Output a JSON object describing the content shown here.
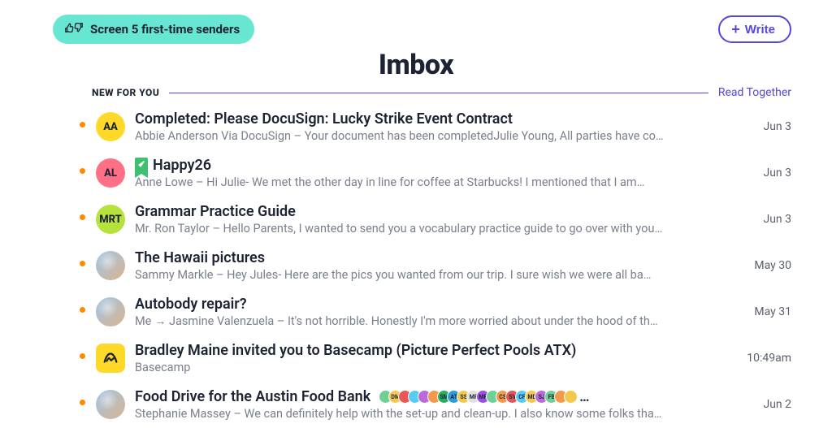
{
  "screener": {
    "label": "Screen 5 first-time senders"
  },
  "write_button": {
    "label": "Write"
  },
  "title": "Imbox",
  "section": {
    "label": "NEW FOR YOU",
    "action": "Read Together"
  },
  "avatars": {
    "aa": {
      "text": "AA",
      "bg": "#ffd92a"
    },
    "al": {
      "text": "AL",
      "bg": "#ff6f86"
    },
    "mrt": {
      "text": "MRT",
      "bg": "#b6e23c"
    },
    "bc_bg": "#ffd92a"
  },
  "mini_colors": [
    "#6fcf97",
    "#f2c94c",
    "#eb5757",
    "#56ccf2",
    "#bb6bd9",
    "#f2994a",
    "#27ae60",
    "#2d9cdb",
    "#f2c94c",
    "#e0e0e0",
    "#9b51e0",
    "#6fcf97",
    "#f2994a",
    "#e05757",
    "#56ccf2",
    "#f2c94c",
    "#bb6bd9",
    "#6fcf97",
    "#f2994a",
    "#f2c94c"
  ],
  "mini_labels": [
    "",
    "DM",
    "",
    "",
    "",
    "",
    "SM",
    "AT",
    "SS",
    "MF",
    "MR",
    "",
    "CS",
    "SV",
    "CP",
    "MD",
    "SJ",
    "FB",
    ""
  ],
  "emails": [
    {
      "avatar_type": "initials",
      "avatar_key": "aa",
      "pinned": false,
      "subject": "Completed: Please DocuSign: Lucky Strike Event Contract",
      "preview": "Abbie Anderson Via DocuSign – Your document has been completedJulie Young, All parties have co…",
      "date": "Jun 3"
    },
    {
      "avatar_type": "initials",
      "avatar_key": "al",
      "pinned": true,
      "subject": "Happy26",
      "preview": "Anne Lowe – Hi Julie- We met the other day in line for coffee at Starbucks! I mentioned that I am…",
      "date": "Jun 3"
    },
    {
      "avatar_type": "initials",
      "avatar_key": "mrt",
      "pinned": false,
      "subject": "Grammar Practice Guide",
      "preview": "Mr. Ron Taylor – Hello Parents, I wanted to send you a vocabulary practice guide to go over with you…",
      "date": "Jun 3"
    },
    {
      "avatar_type": "image",
      "pinned": false,
      "subject": "The Hawaii pictures",
      "preview": "Sammy Markle – Hey Jules- Here are the pics you wanted from our trip. I sure wish we were all ba…",
      "date": "May 30"
    },
    {
      "avatar_type": "image",
      "pinned": false,
      "subject": "Autobody repair?",
      "preview": "Me → Jasmine Valenzuela – It's not horrible. Honestly I'm more worried about under the hood of th…",
      "date": "May 31"
    },
    {
      "avatar_type": "basecamp",
      "pinned": false,
      "subject": "Bradley Maine invited you to Basecamp (Picture Perfect Pools ATX)",
      "preview": "Basecamp",
      "date": "10:49am"
    },
    {
      "avatar_type": "image",
      "pinned": false,
      "has_minis": true,
      "subject": "Food Drive for the Austin Food Bank",
      "preview": "Stephanie Massey – We can definitely help with the set-up and clean-up. I also know some folks tha…",
      "date": "Jun 2"
    }
  ]
}
